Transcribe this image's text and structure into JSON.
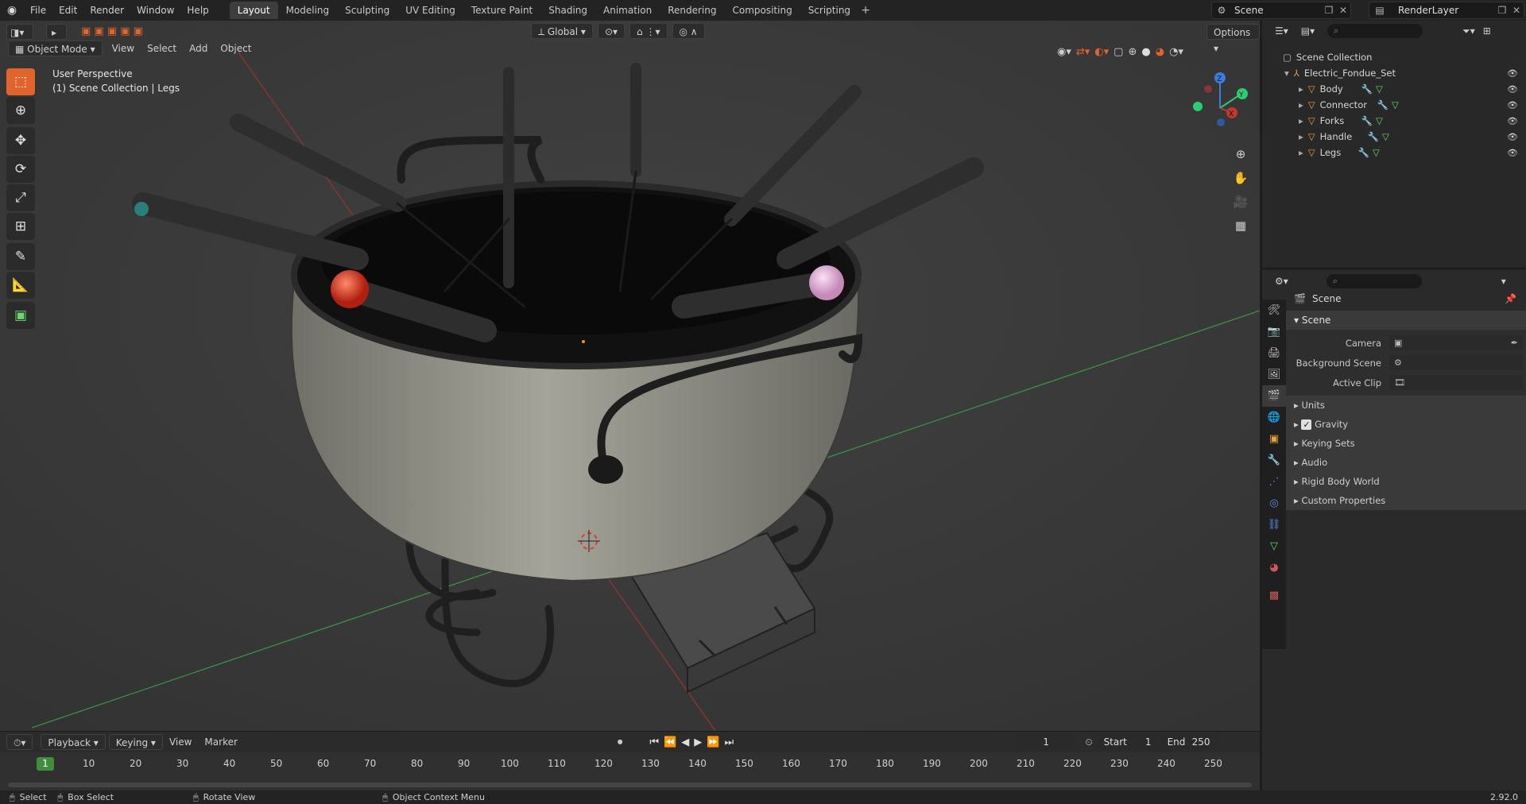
{
  "menu": [
    "File",
    "Edit",
    "Render",
    "Window",
    "Help"
  ],
  "workspaces": [
    "Layout",
    "Modeling",
    "Sculpting",
    "UV Editing",
    "Texture Paint",
    "Shading",
    "Animation",
    "Rendering",
    "Compositing",
    "Scripting"
  ],
  "active_workspace": "Layout",
  "scene_name": "Scene",
  "view_layer": "RenderLayer",
  "viewport": {
    "mode": "Object Mode",
    "menus": [
      "View",
      "Select",
      "Add",
      "Object"
    ],
    "transform_orientation": "Global",
    "options_label": "Options",
    "perspective_label": "User Perspective",
    "collection_label": "(1) Scene Collection | Legs"
  },
  "outliner": {
    "root": "Scene Collection",
    "collection": "Electric_Fondue_Set",
    "objects": [
      "Body",
      "Connector",
      "Forks",
      "Handle",
      "Legs"
    ]
  },
  "properties": {
    "context_title": "Scene",
    "section": "Scene",
    "fields": [
      {
        "label": "Camera",
        "value": ""
      },
      {
        "label": "Background Scene",
        "value": ""
      },
      {
        "label": "Active Clip",
        "value": ""
      }
    ],
    "subpanels": [
      "Units",
      "Gravity",
      "Keying Sets",
      "Audio",
      "Rigid Body World",
      "Custom Properties"
    ],
    "gravity_checked": true
  },
  "timeline": {
    "menus": [
      "Playback",
      "Keying",
      "View",
      "Marker"
    ],
    "current_frame": "1",
    "start_label": "Start",
    "start": "1",
    "end_label": "End",
    "end": "250",
    "ruler_ticks": [
      "1",
      "10",
      "20",
      "30",
      "40",
      "50",
      "60",
      "70",
      "80",
      "90",
      "100",
      "110",
      "120",
      "130",
      "140",
      "150",
      "160",
      "170",
      "180",
      "190",
      "200",
      "210",
      "220",
      "230",
      "240",
      "250"
    ]
  },
  "statusbar": {
    "select": "Select",
    "box_select": "Box Select",
    "rotate": "Rotate View",
    "context_menu": "Object Context Menu",
    "version": "2.92.0"
  },
  "colors": {
    "accent": "#e0642b",
    "playhead": "#3e8e3e",
    "x_axis": "#c0392b",
    "y_axis": "#2ecc71",
    "z_axis": "#3b7ddd"
  }
}
